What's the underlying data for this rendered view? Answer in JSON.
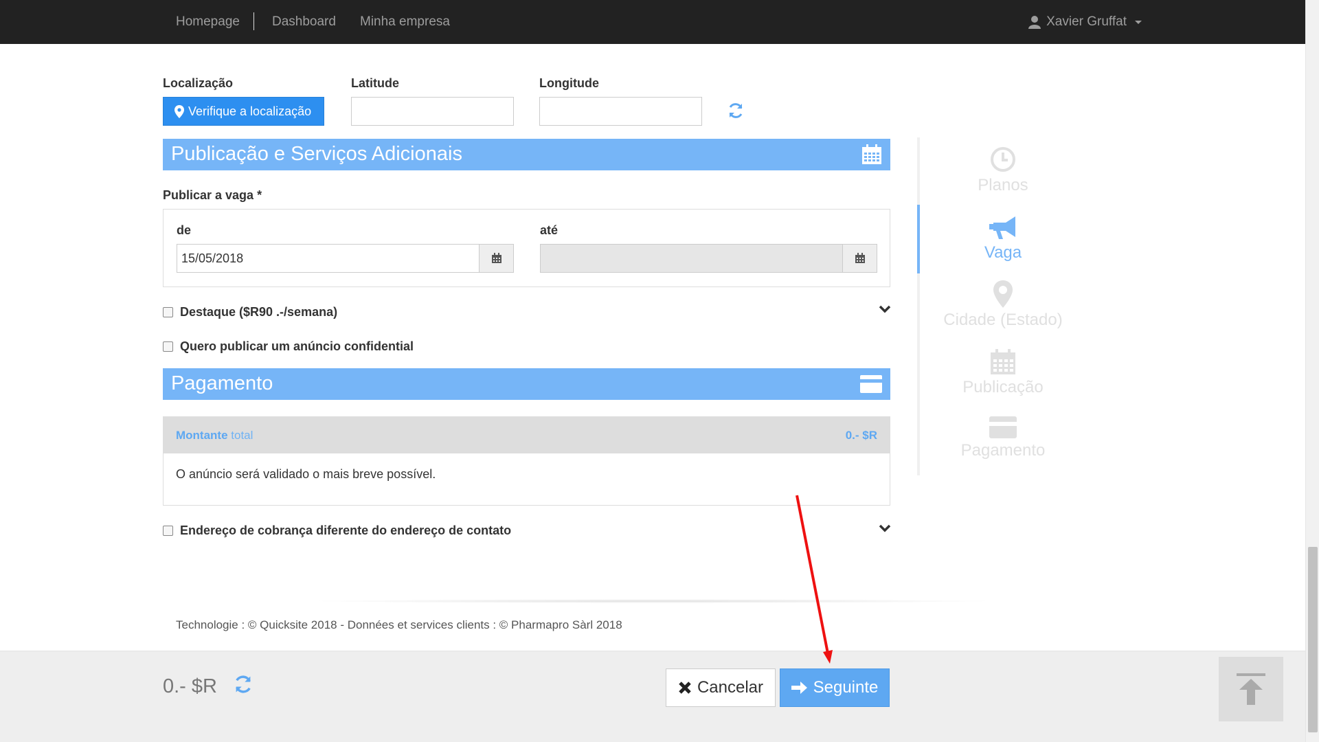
{
  "nav": {
    "homepage": "Homepage",
    "dashboard": "Dashboard",
    "company": "Minha empresa",
    "user": "Xavier Gruffat"
  },
  "location": {
    "label": "Localização",
    "button": "Verifique a localização",
    "latitude_label": "Latitude",
    "latitude_value": "",
    "longitude_label": "Longitude",
    "longitude_value": ""
  },
  "publication": {
    "title": "Publicação e Serviços Adicionais",
    "publish_label": "Publicar a vaga *",
    "from_label": "de",
    "from_value": "15/05/2018",
    "to_label": "até",
    "to_value": "",
    "highlight_option": "Destaque ($R90 .-/semana)",
    "confidential_option": "Quero publicar um anúncio confidential"
  },
  "payment": {
    "title": "Pagamento",
    "amount_strong": "Montante",
    "amount_light": "total",
    "amount_value": "0.- $R",
    "note": "O anúncio será validado o mais breve possível.",
    "billing_option": "Endereço de cobrança diferente do endereço de contato"
  },
  "steps": [
    {
      "label": "Planos",
      "icon": "clock-icon",
      "active": false
    },
    {
      "label": "Vaga",
      "icon": "megaphone-icon",
      "active": true
    },
    {
      "label": "Cidade (Estado)",
      "icon": "map-marker-icon",
      "active": false
    },
    {
      "label": "Publicação",
      "icon": "calendar-icon",
      "active": false
    },
    {
      "label": "Pagamento",
      "icon": "credit-card-icon",
      "active": false
    }
  ],
  "footer": {
    "text": "Technologie : © Quicksite 2018 - Données et services clients : © Pharmapro Sàrl 2018"
  },
  "bottom_bar": {
    "total": "0.- $R",
    "cancel": "Cancelar",
    "next": "Seguinte"
  },
  "colors": {
    "accent": "#76b5f7",
    "primary_button": "#2d8ff0",
    "nav_bg": "#222222",
    "annotation_arrow": "#ee1111"
  }
}
